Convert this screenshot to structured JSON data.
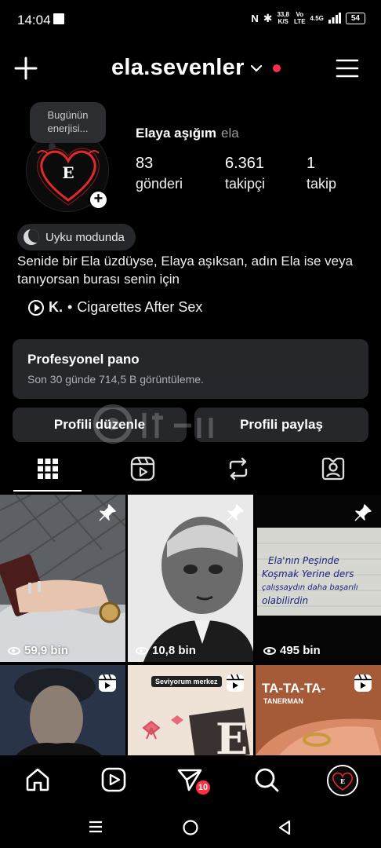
{
  "status_bar": {
    "time": "14:04",
    "net_speed_value": "33,8",
    "net_speed_unit": "K/S",
    "network_top": "Vo",
    "network_bottom": "LTE",
    "signal_label": "4.5G",
    "battery": "54"
  },
  "header": {
    "username": "ela.sevenler",
    "notification_dot_color": "#ff2d4b"
  },
  "profile": {
    "note": "Bugünün enerjisi...",
    "avatar_letter": "E",
    "name": "Elaya aşığım",
    "pronoun": "ela",
    "stats": [
      {
        "value": "83",
        "label": "gönderi"
      },
      {
        "value": "6.361",
        "label": "takipçi"
      },
      {
        "value": "1",
        "label": "takip"
      }
    ],
    "status_pill": "Uyku modunda",
    "bio": "Senide bir Ela üzdüyse, Elaya aşıksan, adın Ela ise veya tanıyorsan burası senin için",
    "music_artist": "K.",
    "music_separator": "•",
    "music_song": "Cigarettes After Sex"
  },
  "dashboard": {
    "title": "Profesyonel pano",
    "subtitle": "Son 30 günde 714,5 B görüntüleme."
  },
  "buttons": {
    "edit_profile": "Profili düzenle",
    "share_profile": "Profili paylaş"
  },
  "tabs": [
    "posts-grid-icon",
    "reels-icon",
    "reposts-icon",
    "tagged-icon"
  ],
  "grid": {
    "posts": [
      {
        "views": "59,9 bin",
        "icon": "pin-icon"
      },
      {
        "views": "10,8 bin",
        "icon": "pin-icon"
      },
      {
        "views": "495 bin",
        "icon": "pin-icon",
        "note_lines": [
          "Ela'nın Peşinde",
          "Koşmak Yerine ders",
          "çalışsaydın daha başarılı",
          "olabilirdin"
        ]
      },
      {
        "icon": "reel-icon"
      },
      {
        "icon": "reel-icon",
        "caption": "Seviyorum merkez",
        "letter": "E"
      },
      {
        "icon": "reel-icon",
        "caption": "TA-TA-TA-",
        "subcaption": "TANERMAN"
      }
    ]
  },
  "bottom_nav": {
    "items": [
      "home-icon",
      "reels-icon",
      "activity-icon",
      "search-icon",
      "profile-avatar"
    ],
    "badge": "10"
  },
  "accent_colors": {
    "background": "#000000",
    "surface": "#25272b",
    "badge_red": "#ff3040"
  }
}
